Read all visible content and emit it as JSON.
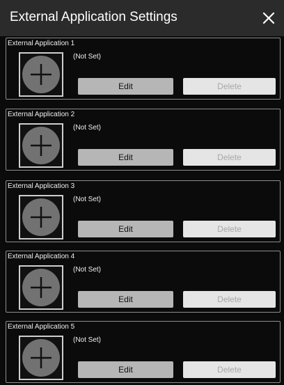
{
  "window": {
    "title": "External Application Settings",
    "close_icon": "close-icon"
  },
  "entries": [
    {
      "title": "External Application 1",
      "status": "(Not Set)",
      "edit_label": "Edit",
      "delete_label": "Delete"
    },
    {
      "title": "External Application 2",
      "status": "(Not Set)",
      "edit_label": "Edit",
      "delete_label": "Delete"
    },
    {
      "title": "External Application 3",
      "status": "(Not Set)",
      "edit_label": "Edit",
      "delete_label": "Delete"
    },
    {
      "title": "External Application 4",
      "status": "(Not Set)",
      "edit_label": "Edit",
      "delete_label": "Delete"
    },
    {
      "title": "External Application 5",
      "status": "(Not Set)",
      "edit_label": "Edit",
      "delete_label": "Delete"
    }
  ],
  "icons": {
    "add": "plus-circle-icon"
  },
  "colors": {
    "background": "#0b0b0b",
    "titlebar": "#2b2b2b",
    "edit_button": "#b6b6b6",
    "delete_button": "#e5e5e5"
  }
}
